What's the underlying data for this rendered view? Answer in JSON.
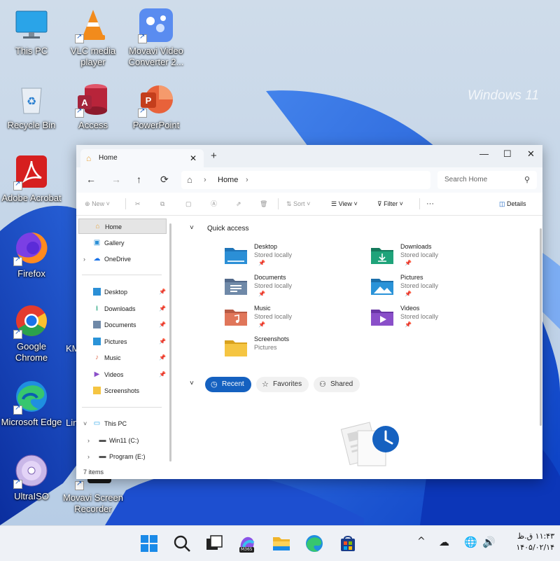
{
  "desktop": {
    "watermark": "Windows 11",
    "icons": [
      {
        "label": "This PC",
        "icon": "this-pc-icon"
      },
      {
        "label": "VLC media player",
        "icon": "vlc-icon"
      },
      {
        "label": "Movavi Video Converter 2...",
        "icon": "movavi-converter-icon"
      },
      {
        "label": "Recycle Bin",
        "icon": "recycle-bin-icon"
      },
      {
        "label": "Access",
        "icon": "access-icon"
      },
      {
        "label": "PowerPoint",
        "icon": "powerpoint-icon"
      },
      {
        "label": "Adobe Acrobat",
        "icon": "acrobat-icon"
      },
      {
        "label": "Firefox",
        "icon": "firefox-icon"
      },
      {
        "label": "Google Chrome",
        "icon": "chrome-icon"
      },
      {
        "label": "Microsoft Edge",
        "icon": "edge-icon"
      },
      {
        "label": "UltraISO",
        "icon": "ultraiso-icon"
      },
      {
        "label": "Movavi Screen Recorder",
        "icon": "movavi-recorder-icon"
      }
    ],
    "partial_labels": [
      "KM",
      "Lin"
    ]
  },
  "explorer": {
    "tab_title": "Home",
    "new_tab": "+",
    "window_buttons": {
      "minimize": "—",
      "maximize": "☐",
      "close": "✕"
    },
    "nav": {
      "back": "←",
      "forward": "→",
      "up": "↑",
      "refresh": "⟳"
    },
    "address": {
      "crumb": "Home"
    },
    "search_placeholder": "Search Home",
    "toolbar": {
      "new": "New",
      "sort": "Sort",
      "view": "View",
      "filter": "Filter",
      "more": "···",
      "details": "Details"
    },
    "sidebar": {
      "top": [
        {
          "label": "Home",
          "icon": "home-icon",
          "selected": true
        },
        {
          "label": "Gallery",
          "icon": "gallery-icon"
        },
        {
          "label": "OneDrive",
          "icon": "onedrive-icon",
          "expandable": true
        }
      ],
      "pinned": [
        {
          "label": "Desktop",
          "icon": "desktop-folder-icon"
        },
        {
          "label": "Downloads",
          "icon": "downloads-folder-icon"
        },
        {
          "label": "Documents",
          "icon": "documents-folder-icon"
        },
        {
          "label": "Pictures",
          "icon": "pictures-folder-icon"
        },
        {
          "label": "Music",
          "icon": "music-folder-icon"
        },
        {
          "label": "Videos",
          "icon": "videos-folder-icon"
        },
        {
          "label": "Screenshots",
          "icon": "screenshots-folder-icon"
        }
      ],
      "this_pc": {
        "label": "This PC",
        "icon": "this-pc-icon"
      },
      "drives": [
        {
          "label": "Win11 (C:)",
          "icon": "drive-icon"
        },
        {
          "label": "Program (E:)",
          "icon": "drive-icon"
        }
      ]
    },
    "status": "7 items",
    "quick_access": {
      "title": "Quick access",
      "items": [
        {
          "name": "Desktop",
          "sub": "Stored locally",
          "color": "#2b8fd6",
          "pinned": true
        },
        {
          "name": "Downloads",
          "sub": "Stored locally",
          "color": "#1fa37a",
          "pinned": true
        },
        {
          "name": "Documents",
          "sub": "Stored locally",
          "color": "#6f89a8",
          "pinned": true
        },
        {
          "name": "Pictures",
          "sub": "Stored locally",
          "color": "#2a93d8",
          "pinned": true
        },
        {
          "name": "Music",
          "sub": "Stored locally",
          "color": "#e0765a",
          "pinned": true
        },
        {
          "name": "Videos",
          "sub": "Stored locally",
          "color": "#8a4fc9",
          "pinned": true
        },
        {
          "name": "Screenshots",
          "sub": "Pictures",
          "color": "#f5c542",
          "pinned": false
        }
      ]
    },
    "recent_tabs": {
      "recent": "Recent",
      "favorites": "Favorites",
      "shared": "Shared"
    }
  },
  "taskbar": {
    "apps": [
      "start-icon",
      "search-icon",
      "task-view-icon",
      "m365-icon",
      "file-explorer-icon",
      "edge-icon",
      "store-icon"
    ],
    "m365_badge": "M365",
    "tray_chevron": "^",
    "clock_time": "۱۱:۴۳ ق.ظ",
    "clock_date": "۱۴۰۵/۰۲/۱۴"
  },
  "colors": {
    "accent": "#1561c0",
    "wallpaper_blue": "#1a56d6",
    "taskbar": "#eef1f6"
  }
}
